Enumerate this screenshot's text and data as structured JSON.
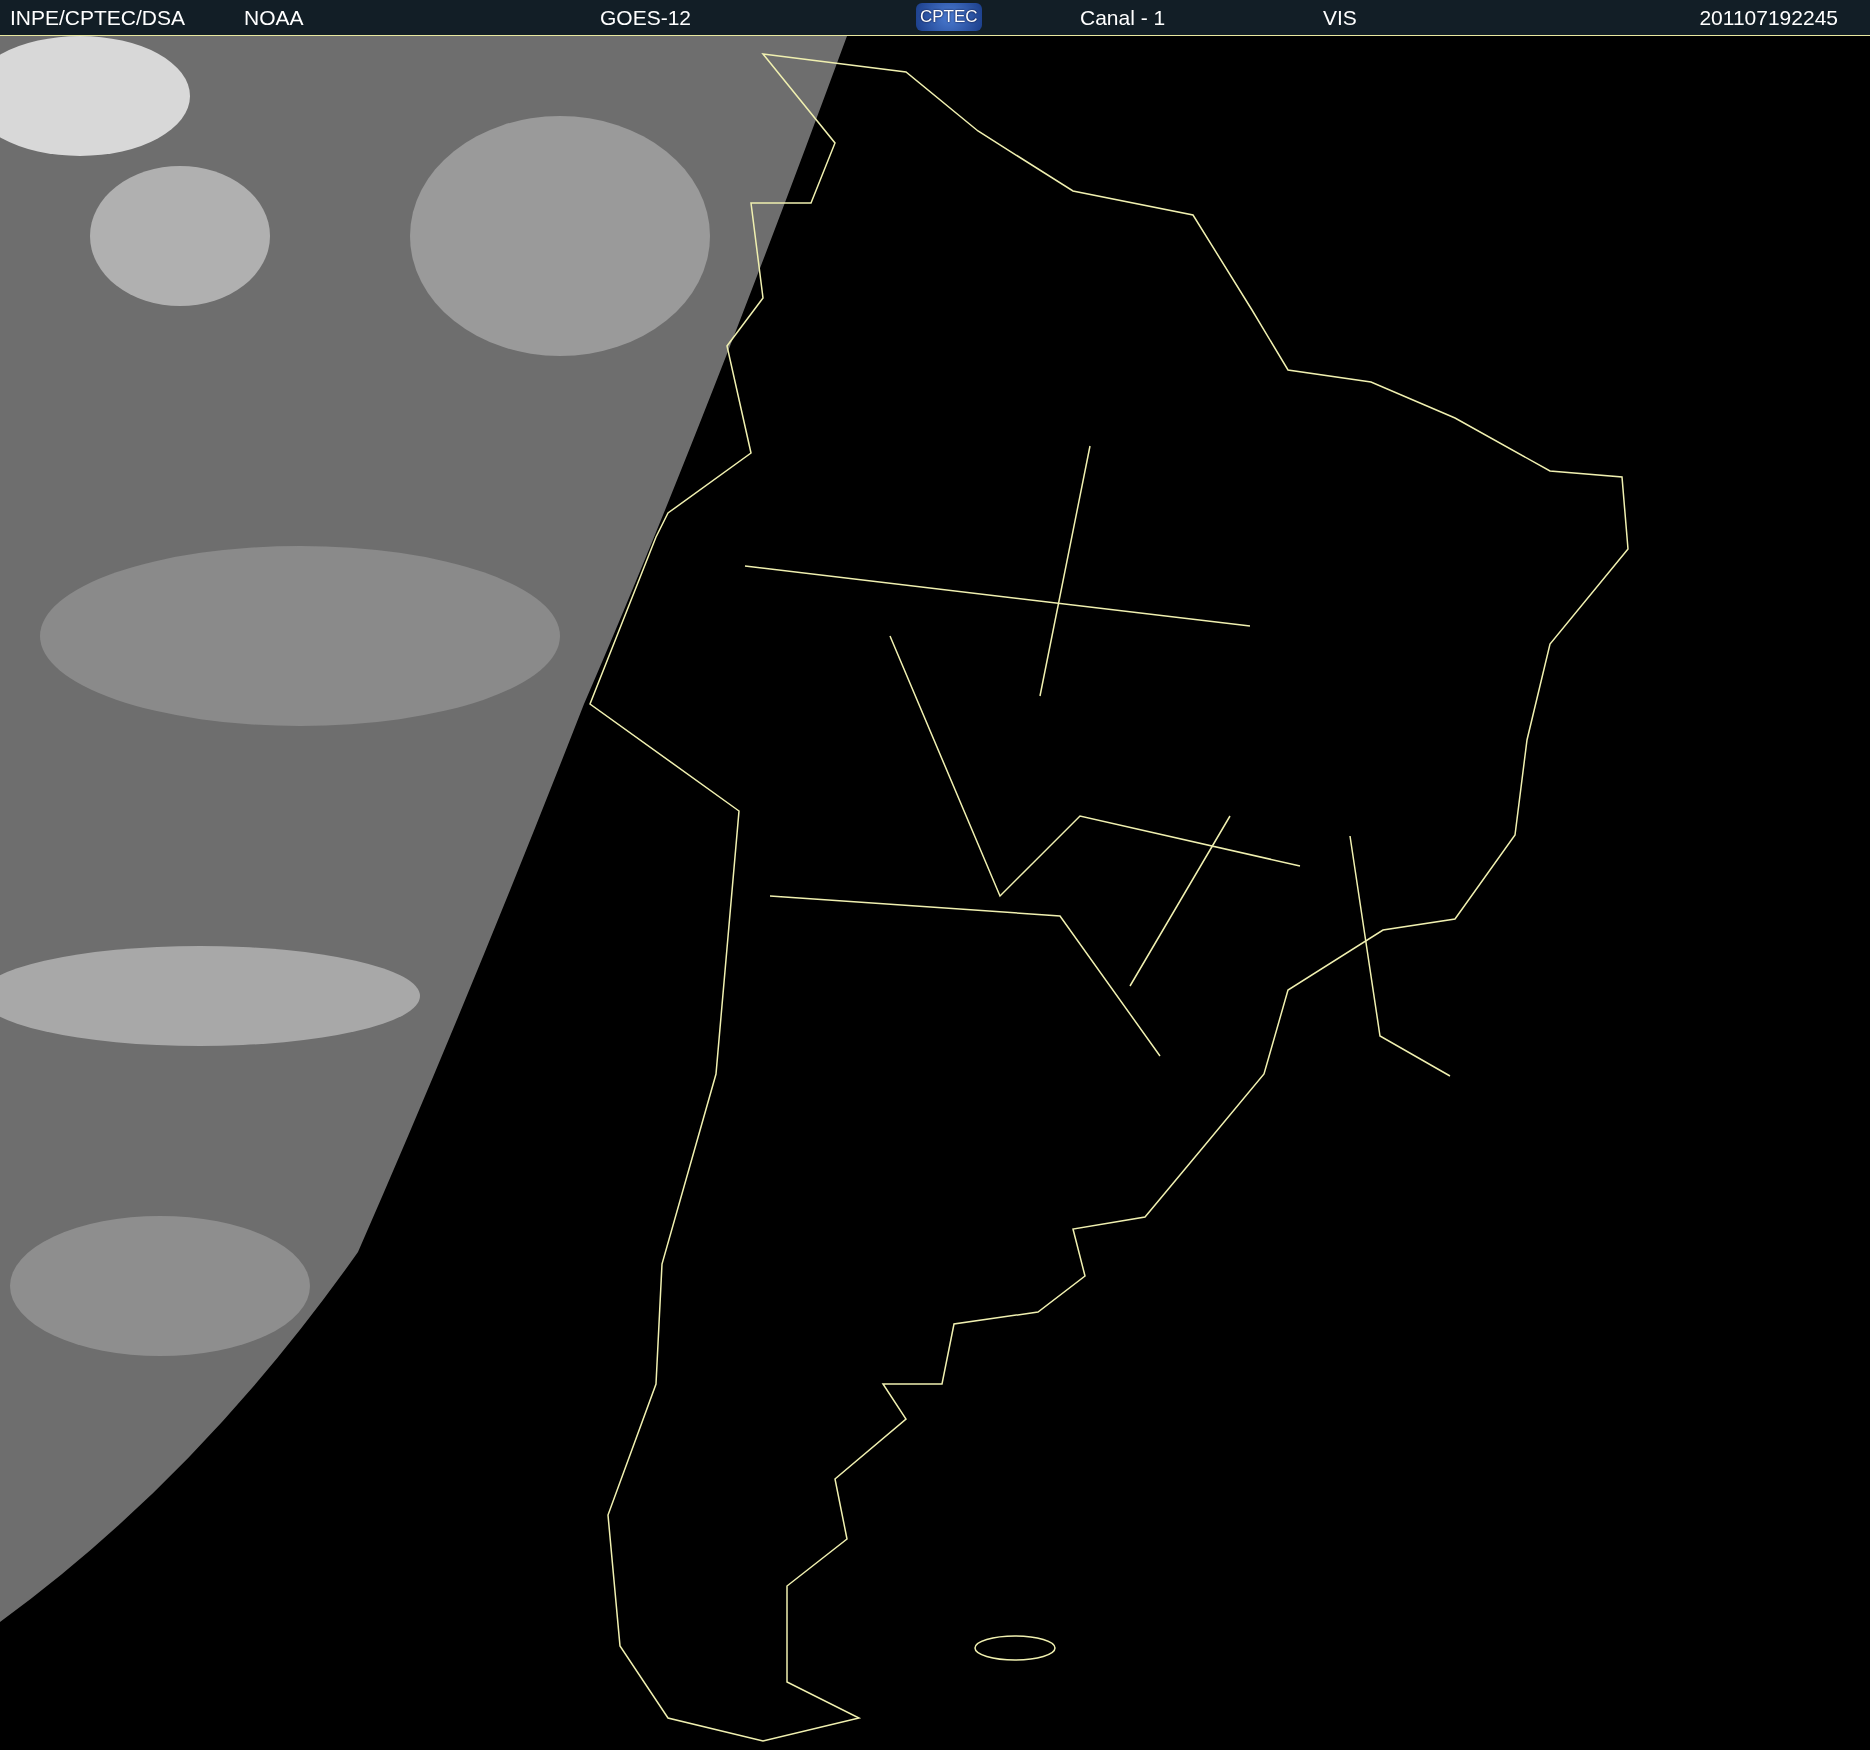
{
  "header": {
    "items": [
      {
        "kind": "text",
        "text": "INPE/CPTEC/DSA"
      },
      {
        "kind": "text",
        "text": "NOAA"
      },
      {
        "kind": "text",
        "text": "GOES-12"
      },
      {
        "kind": "logo",
        "text": "CPTEC"
      },
      {
        "kind": "text",
        "text": "Canal - 1"
      },
      {
        "kind": "text",
        "text": "VIS"
      },
      {
        "kind": "text",
        "text": "201107192245"
      }
    ]
  }
}
